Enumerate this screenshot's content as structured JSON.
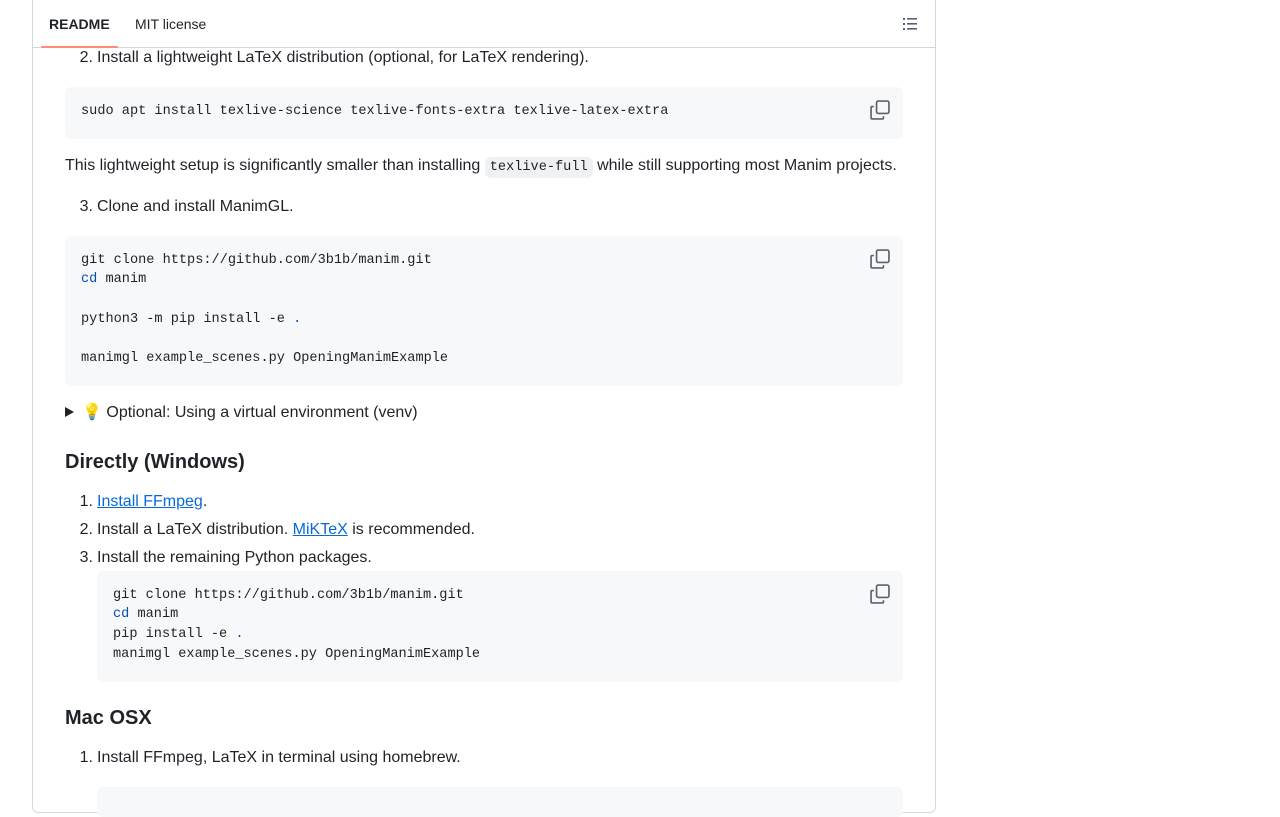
{
  "tabs": {
    "readme": "README",
    "license": "MIT license"
  },
  "icons": {
    "outline": "list-unordered-icon",
    "copy": "copy-icon",
    "bulb": "light-bulb-emoji"
  },
  "step2_linux": {
    "num": "2.",
    "text": "Install a lightweight LaTeX distribution (optional, for LaTeX rendering)."
  },
  "code_latex": {
    "line1": "sudo apt install texlive-science texlive-fonts-extra texlive-latex-extra"
  },
  "lightweight_note": {
    "before": "This lightweight setup is significantly smaller than installing ",
    "code": "texlive-full",
    "after": " while still supporting most Manim projects."
  },
  "step3_linux": {
    "num": "3.",
    "text": "Clone and install ManimGL."
  },
  "code_clone": {
    "line1": "git clone https://github.com/3b1b/manim.git",
    "line2_kw": "cd",
    "line2_rest": " manim",
    "line3_pre": "python3 -m pip install -e ",
    "line3_dot": ".",
    "line4": "manimgl example_scenes.py OpeningManimExample"
  },
  "venv_summary": {
    "emoji": "💡",
    "text": " Optional: Using a virtual environment (venv)"
  },
  "windows": {
    "heading": "Directly (Windows)",
    "step1": {
      "num": "1.",
      "link": "Install FFmpeg",
      "after": "."
    },
    "step2": {
      "num": "2.",
      "before": "Install a LaTeX distribution. ",
      "link": "MiKTeX",
      "after": " is recommended."
    },
    "step3": {
      "num": "3.",
      "text": "Install the remaining Python packages."
    },
    "code": {
      "line1": "git clone https://github.com/3b1b/manim.git",
      "line2_kw": "cd",
      "line2_rest": " manim",
      "line3_pre": "pip install -e ",
      "line3_dot": ".",
      "line4": "manimgl example_scenes.py OpeningManimExample"
    }
  },
  "macos": {
    "heading": "Mac OSX",
    "step1": {
      "num": "1.",
      "text": "Install FFmpeg, LaTeX in terminal using homebrew."
    }
  }
}
